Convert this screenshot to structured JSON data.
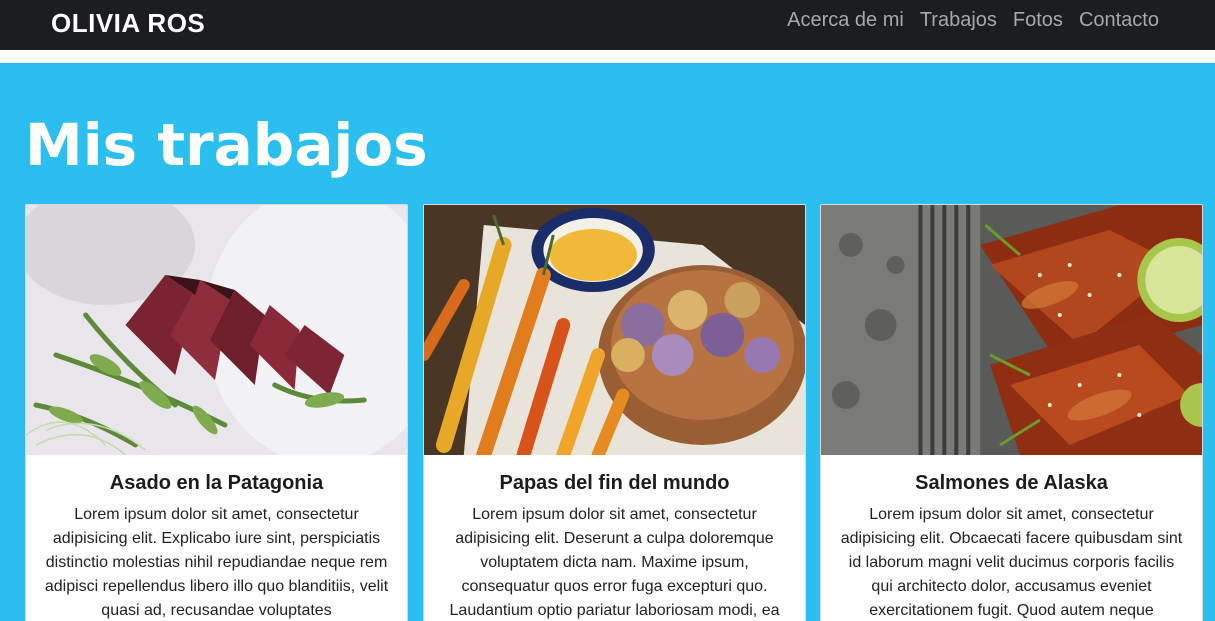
{
  "navbar": {
    "brand": "OLIVIA ROS",
    "links": [
      "Acerca de mi",
      "Trabajos",
      "Fotos",
      "Contacto"
    ]
  },
  "hero": {
    "title": "Mis trabajos"
  },
  "cards": [
    {
      "title": "Asado en la Patagonia",
      "text": "Lorem ipsum dolor sit amet, consectetur adipisicing elit. Explicabo iure sint, perspiciatis distinctio molestias nihil repudiandae neque rem adipisci repellendus libero illo quo blanditiis, velit quasi ad, recusandae voluptates"
    },
    {
      "title": "Papas del fin del mundo",
      "text": "Lorem ipsum dolor sit amet, consectetur adipisicing elit. Deserunt a culpa doloremque voluptatem dicta nam. Maxime ipsum, consequatur quos error fuga excepturi quo. Laudantium optio pariatur laboriosam modi, ea"
    },
    {
      "title": "Salmones de Alaska",
      "text": "Lorem ipsum dolor sit amet, consectetur adipisicing elit. Obcaecati facere quibusdam sint id laborum magni velit ducimus corporis facilis qui architecto dolor, accusamus eveniet exercitationem fugit. Quod autem neque"
    }
  ],
  "colors": {
    "navbar_bg": "#1b1d20",
    "hero_bg": "#2abfef",
    "nav_link": "#a6a8ab"
  }
}
